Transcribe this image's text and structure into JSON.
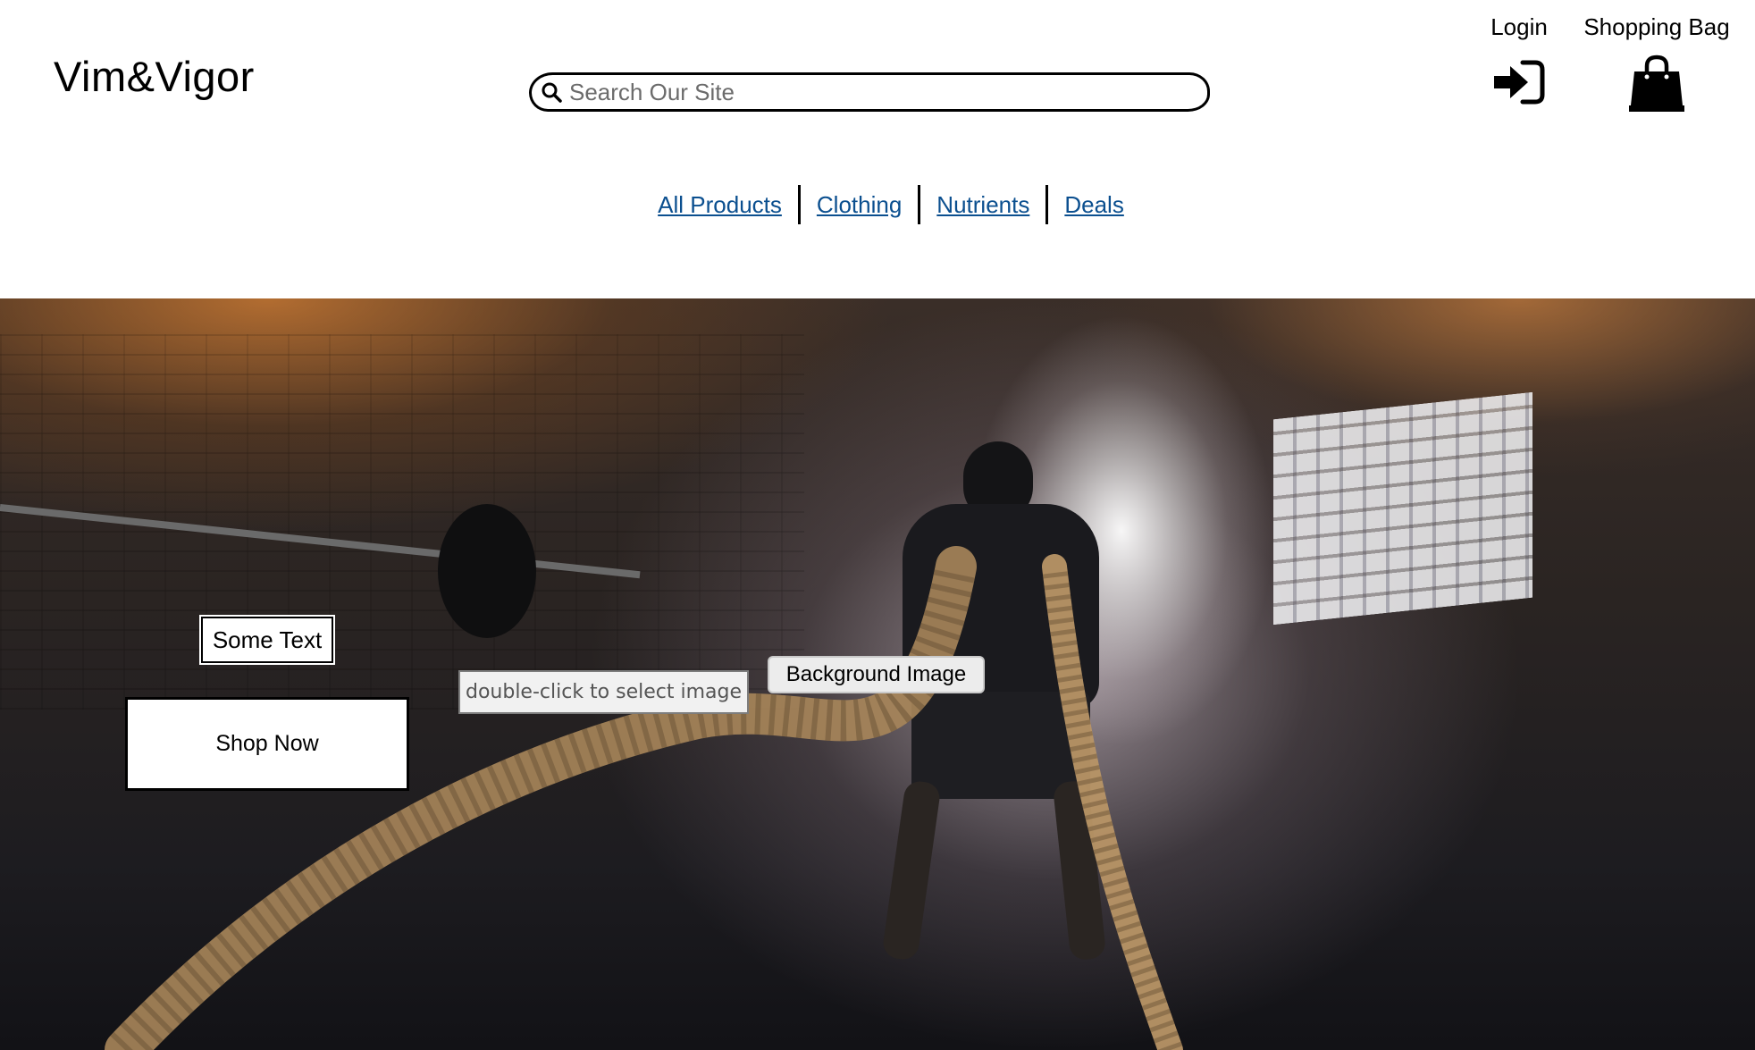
{
  "header": {
    "logo": "Vim&Vigor",
    "search_placeholder": "Search Our Site",
    "login_label": "Login",
    "bag_label": "Shopping Bag"
  },
  "nav": {
    "items": [
      "All Products",
      "Clothing",
      "Nutrients",
      "Deals"
    ]
  },
  "hero": {
    "some_text": "Some Text",
    "shop_now": "Shop Now",
    "tooltip": "double-click to select image",
    "background_label": "Background Image"
  },
  "icons": {
    "search": "search-icon",
    "login": "sign-in-icon",
    "bag": "shopping-bag-icon"
  }
}
